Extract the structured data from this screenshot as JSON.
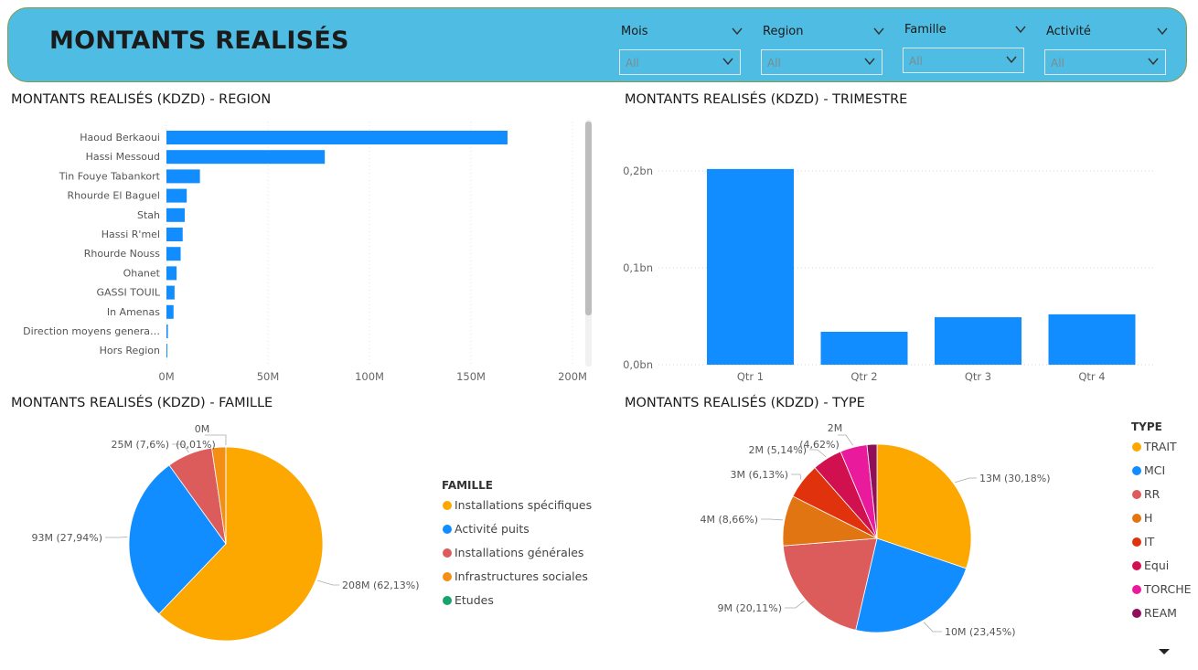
{
  "header": {
    "title": "MONTANTS REALISÉS"
  },
  "slicers": [
    {
      "label": "Mois",
      "value": "All"
    },
    {
      "label": "Region",
      "value": "All"
    },
    {
      "label": "Famille",
      "value": "All"
    },
    {
      "label": "Activité",
      "value": "All"
    }
  ],
  "panels": {
    "region_title": "MONTANTS REALISÉS (KDZD) - REGION",
    "trimestre_title": "MONTANTS REALISÉS (KDZD) - TRIMESTRE",
    "famille_title": "MONTANTS REALISÉS (KDZD) - FAMILLE",
    "type_title": "MONTANTS REALISÉS (KDZD) - TYPE"
  },
  "colors": {
    "blue": "#118dff",
    "header": "#4fbde3"
  },
  "chart_data": [
    {
      "type": "bar",
      "orientation": "horizontal",
      "categories": [
        "Haoud Berkaoui",
        "Hassi Messoud",
        "Tin Fouye Tabankort",
        "Rhourde El Baguel",
        "Stah",
        "Hassi R'mel",
        "Rhourde Nouss",
        "Ohanet",
        "GASSI TOUIL",
        "In Amenas",
        "Direction moyens genera…",
        "Hors Region"
      ],
      "values": [
        168,
        78,
        16.5,
        10,
        9,
        8,
        7,
        5,
        4,
        3.5,
        0.7,
        0.3
      ],
      "xlim": [
        0,
        200
      ],
      "xticks": [
        "0M",
        "50M",
        "100M",
        "150M",
        "200M"
      ],
      "grid": true
    },
    {
      "type": "bar",
      "categories": [
        "Qtr 1",
        "Qtr 2",
        "Qtr 3",
        "Qtr 4"
      ],
      "values": [
        0.202,
        0.034,
        0.049,
        0.052
      ],
      "ylim": [
        0,
        0.2
      ],
      "yticks": [
        "0,0bn",
        "0,1bn",
        "0,2bn"
      ],
      "grid": true
    },
    {
      "type": "pie",
      "legend_title": "FAMILLE",
      "legend_position": "right",
      "slices": [
        {
          "name": "Installations spécifiques",
          "percent": 62.13,
          "label": "208M (62,13%)",
          "color": "#fca800"
        },
        {
          "name": "Activité puits",
          "percent": 27.94,
          "label": "93M (27,94%)",
          "color": "#118dff"
        },
        {
          "name": "Installations générales",
          "percent": 7.6,
          "label": "25M (7,6%)",
          "color": "#dc5b5b"
        },
        {
          "name": "Infrastructures sociales",
          "percent": 2.32,
          "label": "",
          "color": "#f38f15"
        },
        {
          "name": "Etudes",
          "percent": 0.01,
          "label": "0M",
          "label2": "(0,01%)",
          "color": "#17a36b"
        }
      ]
    },
    {
      "type": "pie",
      "legend_title": "TYPE",
      "legend_position": "right",
      "slices": [
        {
          "name": "TRAIT",
          "percent": 30.18,
          "label": "13M (30,18%)",
          "color": "#fca800"
        },
        {
          "name": "MCI",
          "percent": 23.45,
          "label": "10M (23,45%)",
          "color": "#118dff"
        },
        {
          "name": "RR",
          "percent": 20.11,
          "label": "9M (20,11%)",
          "color": "#dc5b5b"
        },
        {
          "name": "H",
          "percent": 8.66,
          "label": "4M (8,66%)",
          "color": "#e07512"
        },
        {
          "name": "IT",
          "percent": 6.13,
          "label": "3M (6,13%)",
          "color": "#e0330d"
        },
        {
          "name": "Equi",
          "percent": 5.14,
          "label": "2M (5,14%)",
          "color": "#d1104f"
        },
        {
          "name": "TORCHE",
          "percent": 4.62,
          "label": "2M",
          "label2": "(4,62%)",
          "color": "#ea1a9c"
        },
        {
          "name": "REAM",
          "percent": 1.71,
          "label": "",
          "color": "#8e0f5a"
        }
      ]
    }
  ]
}
